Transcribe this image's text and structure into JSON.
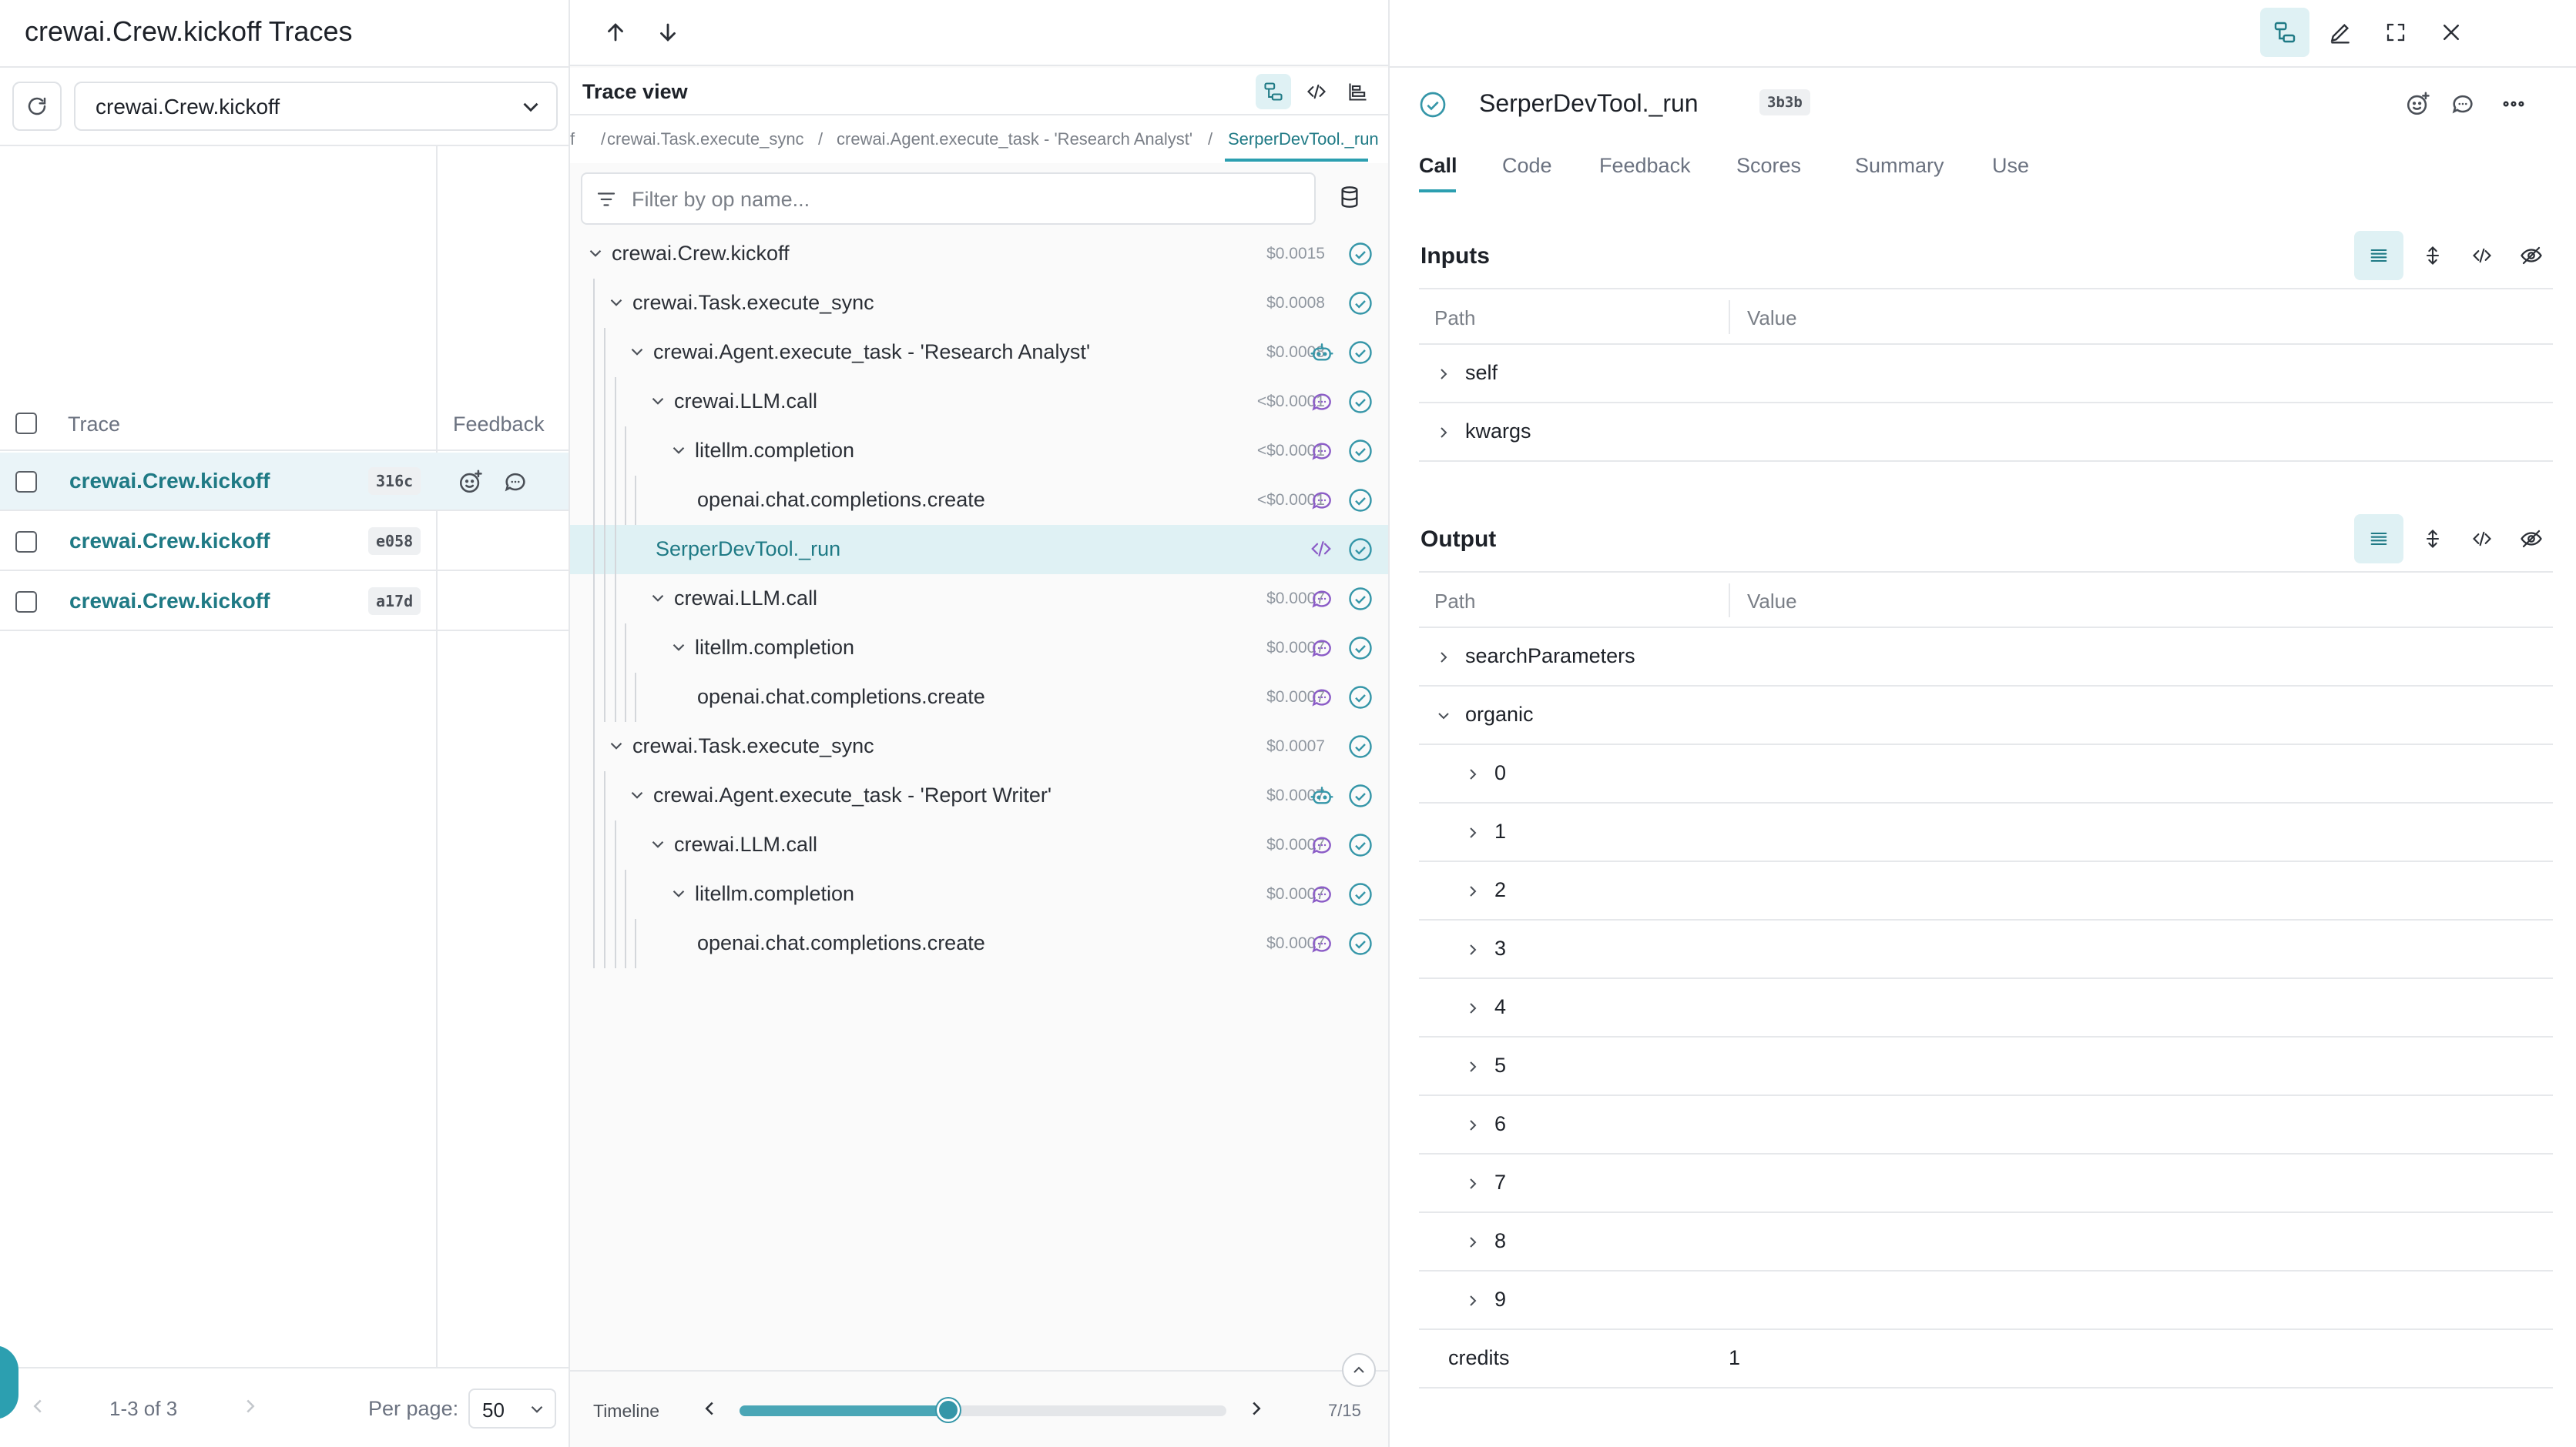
{
  "left": {
    "title": "crewai.Crew.kickoff Traces",
    "op_filter": "crewai.Crew.kickoff",
    "headers": {
      "trace": "Trace",
      "feedback": "Feedback"
    },
    "rows": [
      {
        "name": "crewai.Crew.kickoff",
        "hash": "316c",
        "selected": true
      },
      {
        "name": "crewai.Crew.kickoff",
        "hash": "e058",
        "selected": false
      },
      {
        "name": "crewai.Crew.kickoff",
        "hash": "a17d",
        "selected": false
      }
    ],
    "pagination": {
      "range": "1-3 of 3",
      "per_page_label": "Per page:",
      "per_page": "50"
    }
  },
  "trace_view": {
    "label": "Trace view",
    "breadcrumbs": [
      "f",
      "crewai.Task.execute_sync",
      "crewai.Agent.execute_task - 'Research Analyst'",
      "SerperDevTool._run"
    ],
    "filter_placeholder": "Filter by op name...",
    "nodes": [
      {
        "label": "crewai.Crew.kickoff",
        "cost": "$0.0015",
        "icon": ""
      },
      {
        "label": "crewai.Task.execute_sync",
        "cost": "$0.0008",
        "icon": ""
      },
      {
        "label": "crewai.Agent.execute_task - 'Research Analyst'",
        "cost": "$0.0008",
        "icon": "robot-icon"
      },
      {
        "label": "crewai.LLM.call",
        "cost": "<$0.0001",
        "icon": "chat-icon"
      },
      {
        "label": "litellm.completion",
        "cost": "<$0.0001",
        "icon": "chat-icon"
      },
      {
        "label": "openai.chat.completions.create",
        "cost": "<$0.0001",
        "icon": "chat-icon"
      },
      {
        "label": "SerperDevTool._run",
        "cost": "",
        "icon": "code-icon"
      },
      {
        "label": "crewai.LLM.call",
        "cost": "$0.0007",
        "icon": "chat-icon"
      },
      {
        "label": "litellm.completion",
        "cost": "$0.0007",
        "icon": "chat-icon"
      },
      {
        "label": "openai.chat.completions.create",
        "cost": "$0.0007",
        "icon": "chat-icon"
      },
      {
        "label": "crewai.Task.execute_sync",
        "cost": "$0.0007",
        "icon": ""
      },
      {
        "label": "crewai.Agent.execute_task - 'Report Writer'",
        "cost": "$0.0007",
        "icon": "robot-icon"
      },
      {
        "label": "crewai.LLM.call",
        "cost": "$0.0007",
        "icon": "chat-icon"
      },
      {
        "label": "litellm.completion",
        "cost": "$0.0007",
        "icon": "chat-icon"
      },
      {
        "label": "openai.chat.completions.create",
        "cost": "$0.0007",
        "icon": "chat-icon"
      }
    ],
    "timeline": {
      "label": "Timeline",
      "position": 7,
      "total": 15,
      "count_text": "7/15"
    }
  },
  "call": {
    "title": "SerperDevTool._run",
    "hash": "3b3b",
    "tabs": [
      "Call",
      "Code",
      "Feedback",
      "Scores",
      "Summary",
      "Use"
    ],
    "active_tab": "Call",
    "inputs": {
      "title": "Inputs",
      "headers": {
        "path": "Path",
        "value": "Value"
      },
      "rows": [
        {
          "key": "self"
        },
        {
          "key": "kwargs"
        }
      ]
    },
    "output": {
      "title": "Output",
      "headers": {
        "path": "Path",
        "value": "Value"
      },
      "rows": [
        {
          "key": "searchParameters",
          "depth": 0,
          "expanded": false
        },
        {
          "key": "organic",
          "depth": 0,
          "expanded": true
        },
        {
          "key": "0",
          "depth": 1,
          "expanded": false
        },
        {
          "key": "1",
          "depth": 1,
          "expanded": false
        },
        {
          "key": "2",
          "depth": 1,
          "expanded": false
        },
        {
          "key": "3",
          "depth": 1,
          "expanded": false
        },
        {
          "key": "4",
          "depth": 1,
          "expanded": false
        },
        {
          "key": "5",
          "depth": 1,
          "expanded": false
        },
        {
          "key": "6",
          "depth": 1,
          "expanded": false
        },
        {
          "key": "7",
          "depth": 1,
          "expanded": false
        },
        {
          "key": "8",
          "depth": 1,
          "expanded": false
        },
        {
          "key": "9",
          "depth": 1,
          "expanded": false
        },
        {
          "key": "credits",
          "depth": 0,
          "leaf": true,
          "value": "1"
        }
      ]
    }
  },
  "colors": {
    "accent": "#2c9fb0",
    "link": "#1f7a85",
    "selected_bg": "#dff1f4",
    "chat_icon": "#8b5cc7",
    "robot_icon": "#3596a8"
  }
}
